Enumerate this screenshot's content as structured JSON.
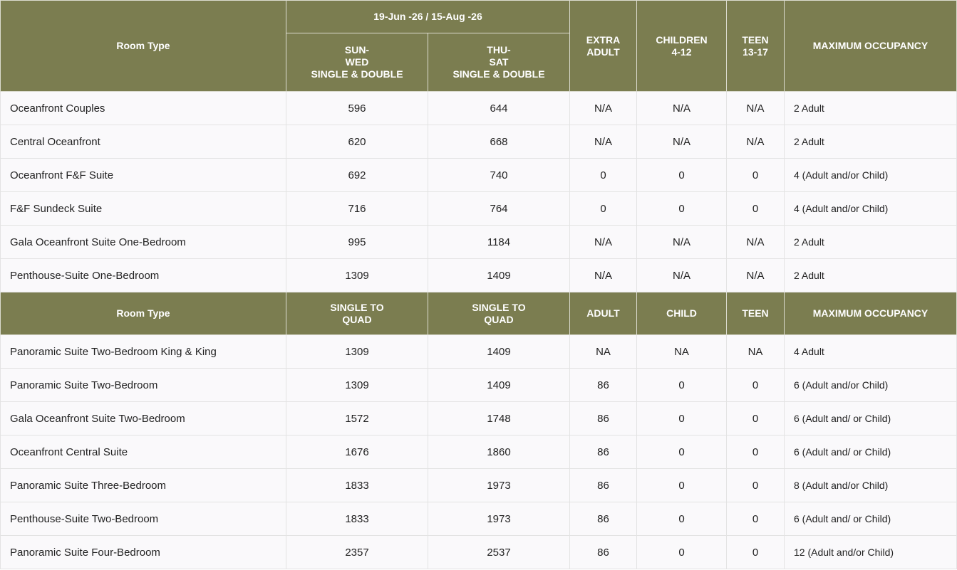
{
  "header1": {
    "room_type": "Room Type",
    "date_range": "19-Jun -26 / 15-Aug -26",
    "sun_wed": "SUN-\nWED\nSINGLE & DOUBLE",
    "thu_sat": "THU-\nSAT\nSINGLE & DOUBLE",
    "extra_adult": "EXTRA\nADULT",
    "children": "CHILDREN\n4-12",
    "teen": "TEEN\n13-17",
    "max_occupancy": "MAXIMUM OCCUPANCY"
  },
  "rows1": [
    {
      "name": "Oceanfront Couples",
      "sun_wed": "596",
      "thu_sat": "644",
      "adult": "N/A",
      "child": "N/A",
      "teen": "N/A",
      "occupancy": "2 Adult"
    },
    {
      "name": "Central Oceanfront",
      "sun_wed": "620",
      "thu_sat": "668",
      "adult": "N/A",
      "child": "N/A",
      "teen": "N/A",
      "occupancy": "2 Adult"
    },
    {
      "name": "Oceanfront F&F Suite",
      "sun_wed": "692",
      "thu_sat": "740",
      "adult": "0",
      "child": "0",
      "teen": "0",
      "occupancy": "4 (Adult and/or Child)"
    },
    {
      "name": "F&F Sundeck Suite",
      "sun_wed": "716",
      "thu_sat": "764",
      "adult": "0",
      "child": "0",
      "teen": "0",
      "occupancy": "4 (Adult and/or Child)"
    },
    {
      "name": "Gala Oceanfront Suite One-Bedroom",
      "sun_wed": "995",
      "thu_sat": "1184",
      "adult": "N/A",
      "child": "N/A",
      "teen": "N/A",
      "occupancy": "2 Adult"
    },
    {
      "name": "Penthouse-Suite One-Bedroom",
      "sun_wed": "1309",
      "thu_sat": "1409",
      "adult": "N/A",
      "child": "N/A",
      "teen": "N/A",
      "occupancy": "2 Adult"
    }
  ],
  "header2": {
    "room_type": "Room Type",
    "col2": "SINGLE TO\nQUAD",
    "col3": "SINGLE TO\nQUAD",
    "adult": "ADULT",
    "child": "CHILD",
    "teen": "TEEN",
    "max_occupancy": "MAXIMUM OCCUPANCY"
  },
  "rows2": [
    {
      "name": "Panoramic Suite Two-Bedroom King & King",
      "sun_wed": "1309",
      "thu_sat": "1409",
      "adult": "NA",
      "child": "NA",
      "teen": "NA",
      "occupancy": "4 Adult"
    },
    {
      "name": "Panoramic Suite Two-Bedroom",
      "sun_wed": "1309",
      "thu_sat": "1409",
      "adult": "86",
      "child": "0",
      "teen": "0",
      "occupancy": "6 (Adult and/or Child)"
    },
    {
      "name": "Gala Oceanfront Suite Two-Bedroom",
      "sun_wed": "1572",
      "thu_sat": "1748",
      "adult": "86",
      "child": "0",
      "teen": "0",
      "occupancy": "6 (Adult and/ or Child)"
    },
    {
      "name": "Oceanfront Central Suite",
      "sun_wed": "1676",
      "thu_sat": "1860",
      "adult": "86",
      "child": "0",
      "teen": "0",
      "occupancy": "6 (Adult and/ or Child)"
    },
    {
      "name": "Panoramic Suite Three-Bedroom",
      "sun_wed": "1833",
      "thu_sat": "1973",
      "adult": "86",
      "child": "0",
      "teen": "0",
      "occupancy": "8 (Adult and/or Child)"
    },
    {
      "name": "Penthouse-Suite Two-Bedroom",
      "sun_wed": "1833",
      "thu_sat": "1973",
      "adult": "86",
      "child": "0",
      "teen": "0",
      "occupancy": "6 (Adult and/ or Child)"
    },
    {
      "name": "Panoramic Suite Four-Bedroom",
      "sun_wed": "2357",
      "thu_sat": "2537",
      "adult": "86",
      "child": "0",
      "teen": "0",
      "occupancy": "12 (Adult and/or Child)"
    }
  ]
}
